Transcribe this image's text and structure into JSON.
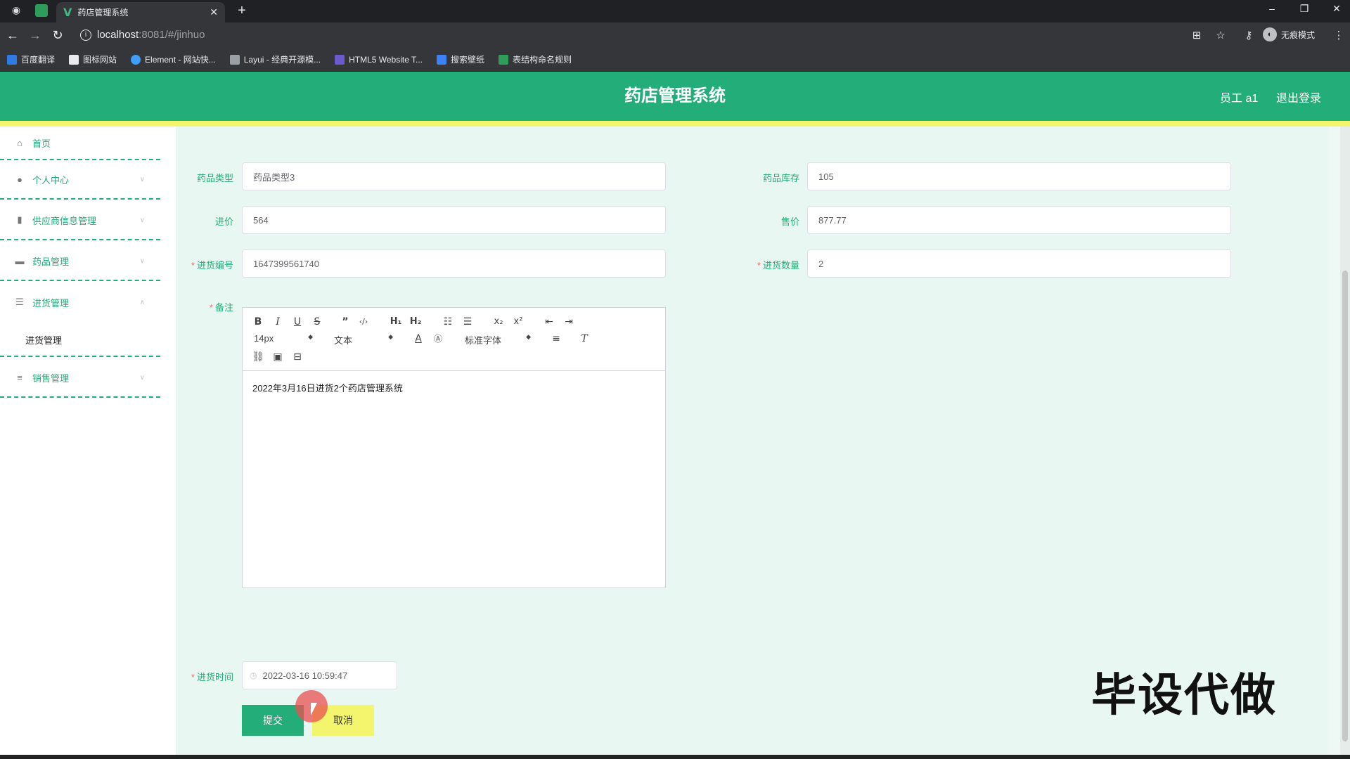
{
  "browser": {
    "tab_title": "药店管理系统",
    "url_host": "localhost",
    "url_rest": ":8081/#/jinhuo",
    "incognito_label": "无痕模式",
    "bookmarks": [
      "百度翻译",
      "图标网站",
      "Element - 网站快...",
      "Layui - 经典开源模...",
      "HTML5 Website T...",
      "搜索壁纸",
      "表结构命名规则"
    ]
  },
  "header": {
    "title": "药店管理系统",
    "user": "员工 a1",
    "logout": "退出登录"
  },
  "sidebar": {
    "items": [
      {
        "label": "首页",
        "icon": "home-icon"
      },
      {
        "label": "个人中心",
        "icon": "user-icon"
      },
      {
        "label": "供应商信息管理",
        "icon": "chart-icon"
      },
      {
        "label": "药品管理",
        "icon": "monitor-icon"
      },
      {
        "label": "进货管理",
        "icon": "list-icon"
      },
      {
        "label": "销售管理",
        "icon": "sliders-icon"
      }
    ],
    "submenu_label": "进货管理"
  },
  "form": {
    "drug_type_label": "药品类型",
    "drug_type_value": "药品类型3",
    "stock_label": "药品库存",
    "stock_value": "105",
    "purchase_price_label": "进价",
    "purchase_price_value": "564",
    "sale_price_label": "售价",
    "sale_price_value": "877.77",
    "purchase_no_label": "进货编号",
    "purchase_no_value": "1647399561740",
    "purchase_qty_label": "进货数量",
    "purchase_qty_value": "2",
    "remark_label": "备注",
    "editor": {
      "font_size": "14px",
      "block_type": "文本",
      "font_family": "标准字体",
      "content": "2022年3月16日进货2个药店管理系统"
    },
    "time_label": "进货时间",
    "time_value": "2022-03-16 10:59:47",
    "submit_label": "提交",
    "cancel_label": "取消"
  },
  "watermark": "毕设代做"
}
